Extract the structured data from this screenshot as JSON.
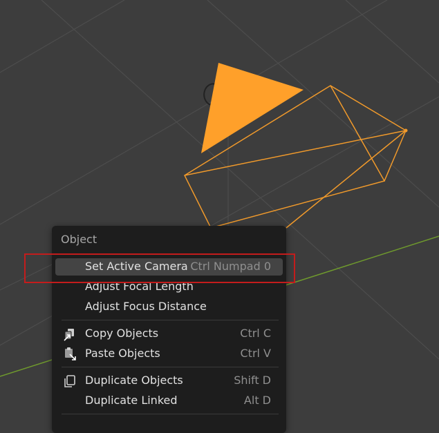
{
  "viewport": {
    "colors": {
      "background": "#3d3d3d",
      "grid": "#4d4d4d",
      "x_axis": "#6f9a2d",
      "camera_wire": "#f19a2b",
      "camera_triangle": "#ffa02a"
    }
  },
  "context_menu": {
    "title": "Object",
    "items": [
      {
        "label": "Set Active Camera",
        "shortcut": "Ctrl Numpad 0",
        "icon": "",
        "active": true
      },
      {
        "label": "Adjust Focal Length",
        "shortcut": "",
        "icon": ""
      },
      {
        "label": "Adjust Focus Distance",
        "shortcut": "",
        "icon": ""
      },
      {
        "label": "Copy Objects",
        "shortcut": "Ctrl C",
        "icon": "copy-objects-icon"
      },
      {
        "label": "Paste Objects",
        "shortcut": "Ctrl V",
        "icon": "paste-objects-icon"
      },
      {
        "label": "Duplicate Objects",
        "shortcut": "Shift D",
        "icon": "duplicate-objects-icon"
      },
      {
        "label": "Duplicate Linked",
        "shortcut": "Alt D",
        "icon": ""
      }
    ],
    "colors": {
      "background": "#1d1d1d",
      "active_item": "#444444",
      "highlight_outline": "#c41c1c"
    }
  }
}
